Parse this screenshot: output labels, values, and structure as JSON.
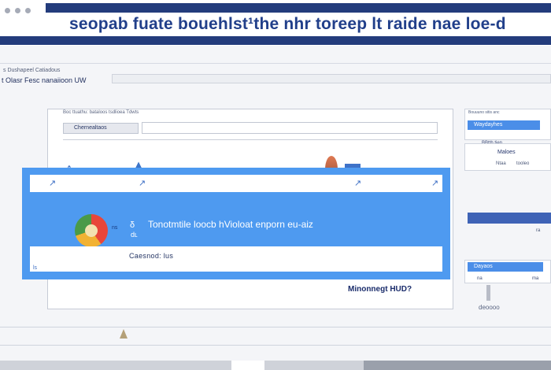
{
  "header": {
    "title": "seopab fuate bouehlst¹the nhr toreep lt raide nae loe-d"
  },
  "subheader": {
    "line1": "s Dushapeel Catiadous",
    "line2": "t Olasr Fesc nanaiioon UW"
  },
  "panel": {
    "top_line": "Boc ttuathu: bataloos tsdlioea Tdwts",
    "chip_label": "Chernealtaos"
  },
  "dialog": {
    "sign_a": "ns",
    "sign_b": "δ",
    "sign_c": "dʟ",
    "message": "Tonotmtile loocb hVioloat enporn eu-aiz",
    "footer_label": "Caesnod: lus",
    "corner_label": "ls"
  },
  "status": {
    "label": "Minonnegt HUD?"
  },
  "sidebar": {
    "card1_caption": "Bouuuno sitis anc",
    "card1_button": "Waydayhes",
    "card1_note": "BBtth tien",
    "card2_title": "Maloes",
    "card2_left": "Ntaa",
    "card2_right": "tooleo",
    "bar_label": "ra",
    "card3_button": "Dayaos",
    "card3_left": "na",
    "card3_right": "ma",
    "status": "deoooo"
  },
  "colors": {
    "brand": "#233c7c",
    "accent": "#4e9af0",
    "title": "#213f8a"
  },
  "icons": {
    "window_controls": "window-dot-icons",
    "app_logo": "pie-logo-icon",
    "updown": "up-down-arrow-icon",
    "up": "up-arrow-icon",
    "cursor": "mouse-pointer-icon"
  }
}
